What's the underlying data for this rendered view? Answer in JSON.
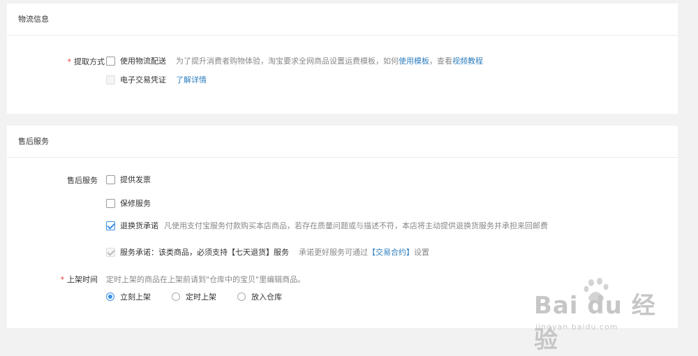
{
  "logistics": {
    "title": "物流信息",
    "pickup_label": "提取方式",
    "options": [
      {
        "label": "使用物流配送",
        "checked": false,
        "disabled": false,
        "desc_before": "为了提升消费者购物体验，淘宝要求全网商品设置运费模板，如何",
        "link1": "使用模板",
        "desc_middle": "，查看",
        "link2": "视频教程"
      },
      {
        "label": "电子交易凭证",
        "checked": false,
        "disabled": true,
        "link": "了解详情"
      }
    ]
  },
  "after_sales": {
    "title": "售后服务",
    "service_label": "售后服务",
    "options": [
      {
        "label": "提供发票",
        "checked": false
      },
      {
        "label": "保修服务",
        "checked": false
      },
      {
        "label": "退换货承诺",
        "checked": true,
        "desc": "凡使用支付宝服务付款购买本店商品，若存在质量问题或与描述不符，本店将主动提供退换货服务并承担来回邮费"
      },
      {
        "label": "服务承诺：该类商品，必须支持【七天退货】服务",
        "checked": true,
        "disabled": true,
        "desc_before": "承诺更好服务可通过",
        "link": "【交易合约】",
        "desc_after": "设置"
      }
    ],
    "listing_label": "上架时间",
    "listing_hint": "定时上架的商品在上架前请到\"仓库中的宝贝\"里编辑商品。",
    "radios": [
      {
        "label": "立刻上架",
        "selected": true
      },
      {
        "label": "定时上架",
        "selected": false
      },
      {
        "label": "放入仓库",
        "selected": false
      }
    ]
  },
  "watermark": {
    "brand": "Bai du 经验",
    "url": "jingyan.baidu.com"
  },
  "colors": {
    "accent": "#3a8ee6",
    "link": "#2f7fbf",
    "required": "#e33333",
    "background": "#f2f2f2"
  }
}
